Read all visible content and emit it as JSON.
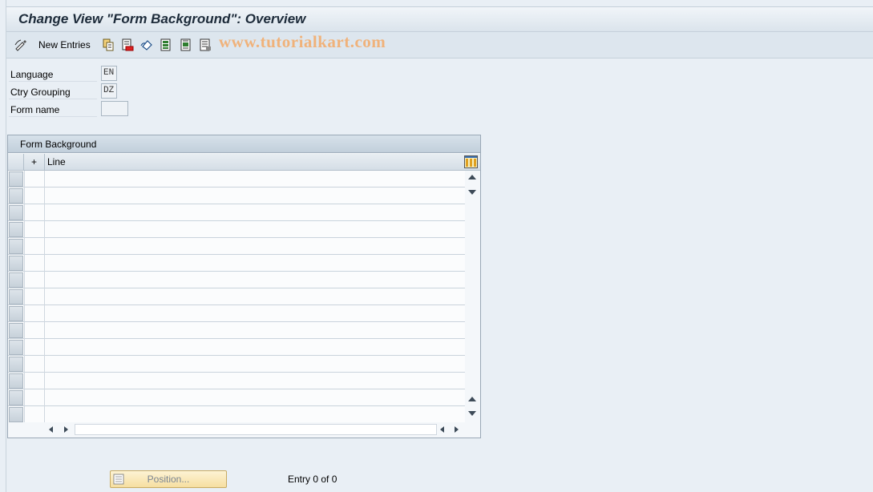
{
  "title": "Change View \"Form Background\": Overview",
  "watermark": "www.tutorialkart.com",
  "toolbar": {
    "new_entries_label": "New Entries",
    "icons": [
      "display-change-icon",
      "copy-icon",
      "delete-icon",
      "undo-icon",
      "select-all-icon",
      "select-block-icon",
      "deselect-all-icon"
    ]
  },
  "fields": [
    {
      "label": "Language",
      "value": "EN"
    },
    {
      "label": "Ctry Grouping",
      "value": "DZ"
    },
    {
      "label": "Form name",
      "value": ""
    }
  ],
  "table": {
    "title": "Form Background",
    "col_plus": "+",
    "col_line": "Line",
    "row_count": 15
  },
  "footer": {
    "position_label": "Position...",
    "entry_info": "Entry 0 of 0"
  },
  "colors": {
    "background": "#e9eff5",
    "watermark": "#f0b27a",
    "position_button": "#f6dfa0"
  }
}
